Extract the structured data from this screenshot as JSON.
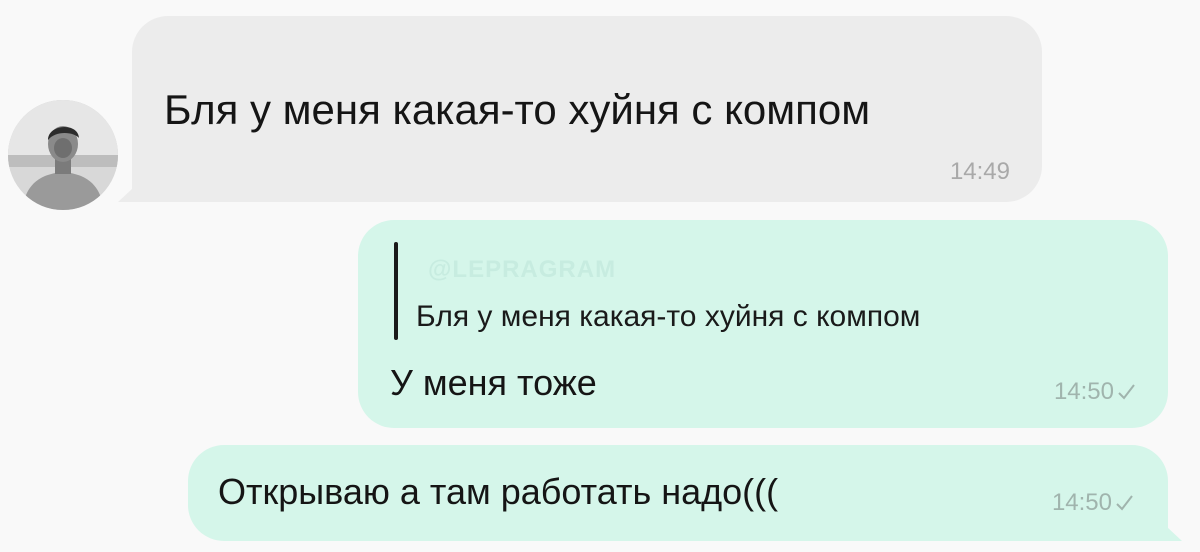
{
  "messages": [
    {
      "direction": "incoming",
      "text": "Бля у меня какая-то хуйня с компом",
      "time": "14:49"
    },
    {
      "direction": "outgoing",
      "reply_watermark": "@LEPRAGRAM",
      "reply_quote": "Бля у меня какая-то хуйня с компом",
      "text": "У меня тоже",
      "time": "14:50",
      "status_icon": "check-icon"
    },
    {
      "direction": "outgoing",
      "text": "Открываю а там работать надо(((",
      "time": "14:50",
      "status_icon": "check-icon"
    }
  ],
  "colors": {
    "background": "#f9f9f9",
    "incoming_bubble": "#ececec",
    "outgoing_bubble": "#d5f6ea",
    "time_text": "#a9a9a9",
    "outgoing_time_text": "#a0b4ad",
    "message_text": "#151515"
  },
  "avatar": {
    "icon": "avatar-photo"
  }
}
